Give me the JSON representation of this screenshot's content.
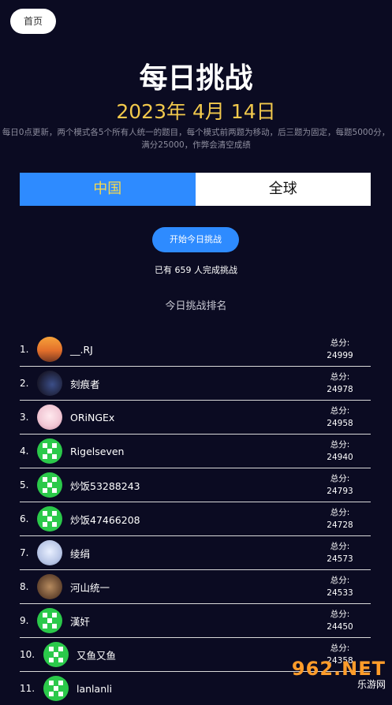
{
  "header": {
    "home_label": "首页",
    "title": "每日挑战",
    "date": "2023年 4月 14日",
    "description": "每日0点更新，两个模式各5个所有人统一的题目，每个模式前两题为移动，后三题为固定，每题5000分，满分25000，作弊会清空成绩"
  },
  "tabs": [
    {
      "label": "中国",
      "active": true
    },
    {
      "label": "全球",
      "active": false
    }
  ],
  "actions": {
    "start_label": "开始今日挑战",
    "completed_text": "已有 659 人完成挑战"
  },
  "ranking": {
    "title": "今日挑战排名",
    "score_label": "总分:",
    "rows": [
      {
        "rank": "1.",
        "name": "__.RJ",
        "score": "24999",
        "avatar": "orange-avatar"
      },
      {
        "rank": "2.",
        "name": "刻痕者",
        "score": "24978",
        "avatar": "dark-avatar"
      },
      {
        "rank": "3.",
        "name": "ORiNGEx",
        "score": "24958",
        "avatar": "anime-avatar"
      },
      {
        "rank": "4.",
        "name": "Rigelseven",
        "score": "24940",
        "avatar": "green-default-avatar"
      },
      {
        "rank": "5.",
        "name": "炒饭53288243",
        "score": "24793",
        "avatar": "green-default-avatar"
      },
      {
        "rank": "6.",
        "name": "炒饭47466208",
        "score": "24728",
        "avatar": "green-default-avatar"
      },
      {
        "rank": "7.",
        "name": "绫绢",
        "score": "24573",
        "avatar": "anime-blue-avatar"
      },
      {
        "rank": "8.",
        "name": "河山统一",
        "score": "24533",
        "avatar": "brown-avatar"
      },
      {
        "rank": "9.",
        "name": "漢奸",
        "score": "24450",
        "avatar": "green-default-avatar"
      },
      {
        "rank": "10.",
        "name": "又鱼又鱼",
        "score": "24358",
        "avatar": "green-default-avatar"
      },
      {
        "rank": "11.",
        "name": "lanlanli",
        "score": "",
        "avatar": "green-default-avatar"
      }
    ]
  },
  "watermark": {
    "big": "962.NET",
    "small": "乐游网"
  }
}
